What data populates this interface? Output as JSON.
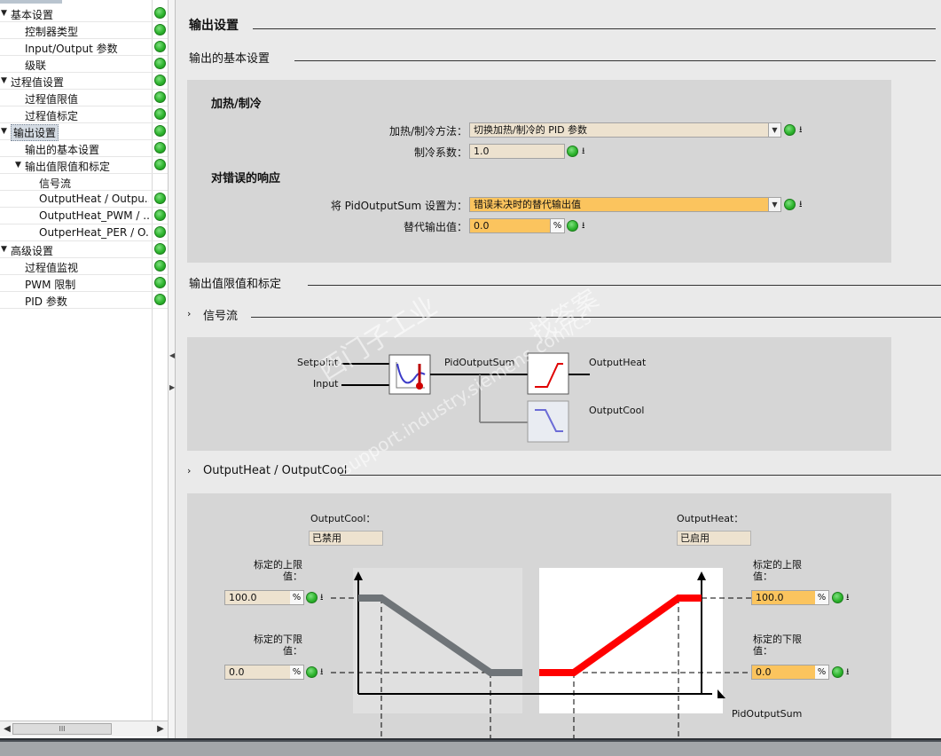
{
  "tree": {
    "items": [
      {
        "label": "基本设置",
        "level": 0,
        "expanded": true,
        "status": "ok"
      },
      {
        "label": "控制器类型",
        "level": 1,
        "status": "ok"
      },
      {
        "label": "Input/Output 参数",
        "level": 1,
        "status": "ok"
      },
      {
        "label": "级联",
        "level": 1,
        "status": "ok"
      },
      {
        "label": "过程值设置",
        "level": 0,
        "expanded": true,
        "status": "ok"
      },
      {
        "label": "过程值限值",
        "level": 1,
        "status": "ok"
      },
      {
        "label": "过程值标定",
        "level": 1,
        "status": "ok"
      },
      {
        "label": "输出设置",
        "level": 0,
        "expanded": true,
        "selected": true,
        "status": "ok"
      },
      {
        "label": "输出的基本设置",
        "level": 1,
        "status": "ok"
      },
      {
        "label": "输出值限值和标定",
        "level": 1,
        "expanded": true,
        "status": "ok"
      },
      {
        "label": "信号流",
        "level": 2,
        "status": "none"
      },
      {
        "label": "OutputHeat / Outpu...",
        "level": 2,
        "status": "ok"
      },
      {
        "label": "OutputHeat_PWM / ...",
        "level": 2,
        "status": "ok"
      },
      {
        "label": "OutperHeat_PER / O...",
        "level": 2,
        "status": "ok"
      },
      {
        "label": "高级设置",
        "level": 0,
        "expanded": true,
        "status": "ok"
      },
      {
        "label": "过程值监视",
        "level": 1,
        "status": "ok"
      },
      {
        "label": "PWM 限制",
        "level": 1,
        "status": "ok"
      },
      {
        "label": "PID 参数",
        "level": 1,
        "status": "ok"
      }
    ]
  },
  "main": {
    "page_title": "输出设置",
    "section_basic": "输出的基本设置",
    "heat_cool_title": "加热/制冷",
    "method_label": "加热/制冷方法：",
    "method_value": "切换加热/制冷的 PID 参数",
    "cool_factor_label": "制冷系数：",
    "cool_factor_value": "1.0",
    "error_title": "对错误的响应",
    "set_pidsum_label": "将 PidOutputSum 设置为：",
    "set_pidsum_value": "错误未决时的替代输出值",
    "subst_label": "替代输出值：",
    "subst_value": "0.0",
    "unit_percent": "%",
    "section_limits": "输出值限值和标定",
    "sub_signal": "信号流",
    "sub_heatcool": "OutputHeat / OutputCool",
    "signal": {
      "setpoint": "Setpoint",
      "input": "Input",
      "pidsum": "PidOutputSum",
      "out_heat": "OutputHeat",
      "out_cool": "OutputCool"
    },
    "scaling": {
      "cool_label": "OutputCool：",
      "cool_state": "已禁用",
      "heat_label": "OutputHeat：",
      "heat_state": "已启用",
      "upper_label": "标定的上限值：",
      "lower_label": "标定的下限值：",
      "cool_upper": "100.0",
      "cool_lower": "0.0",
      "heat_upper": "100.0",
      "heat_lower": "0.0",
      "axis_label": "PidOutputSum"
    },
    "watermark_1": "西门子工业",
    "watermark_2": "找答案",
    "watermark_3": "support.industry.siemens.com/cs"
  },
  "colors": {
    "heat": "#ff0000",
    "cool": "#6f7478",
    "status_ok": "#2fb52f",
    "input_bg": "#ede2cf",
    "input_orange": "#fbc45e"
  }
}
